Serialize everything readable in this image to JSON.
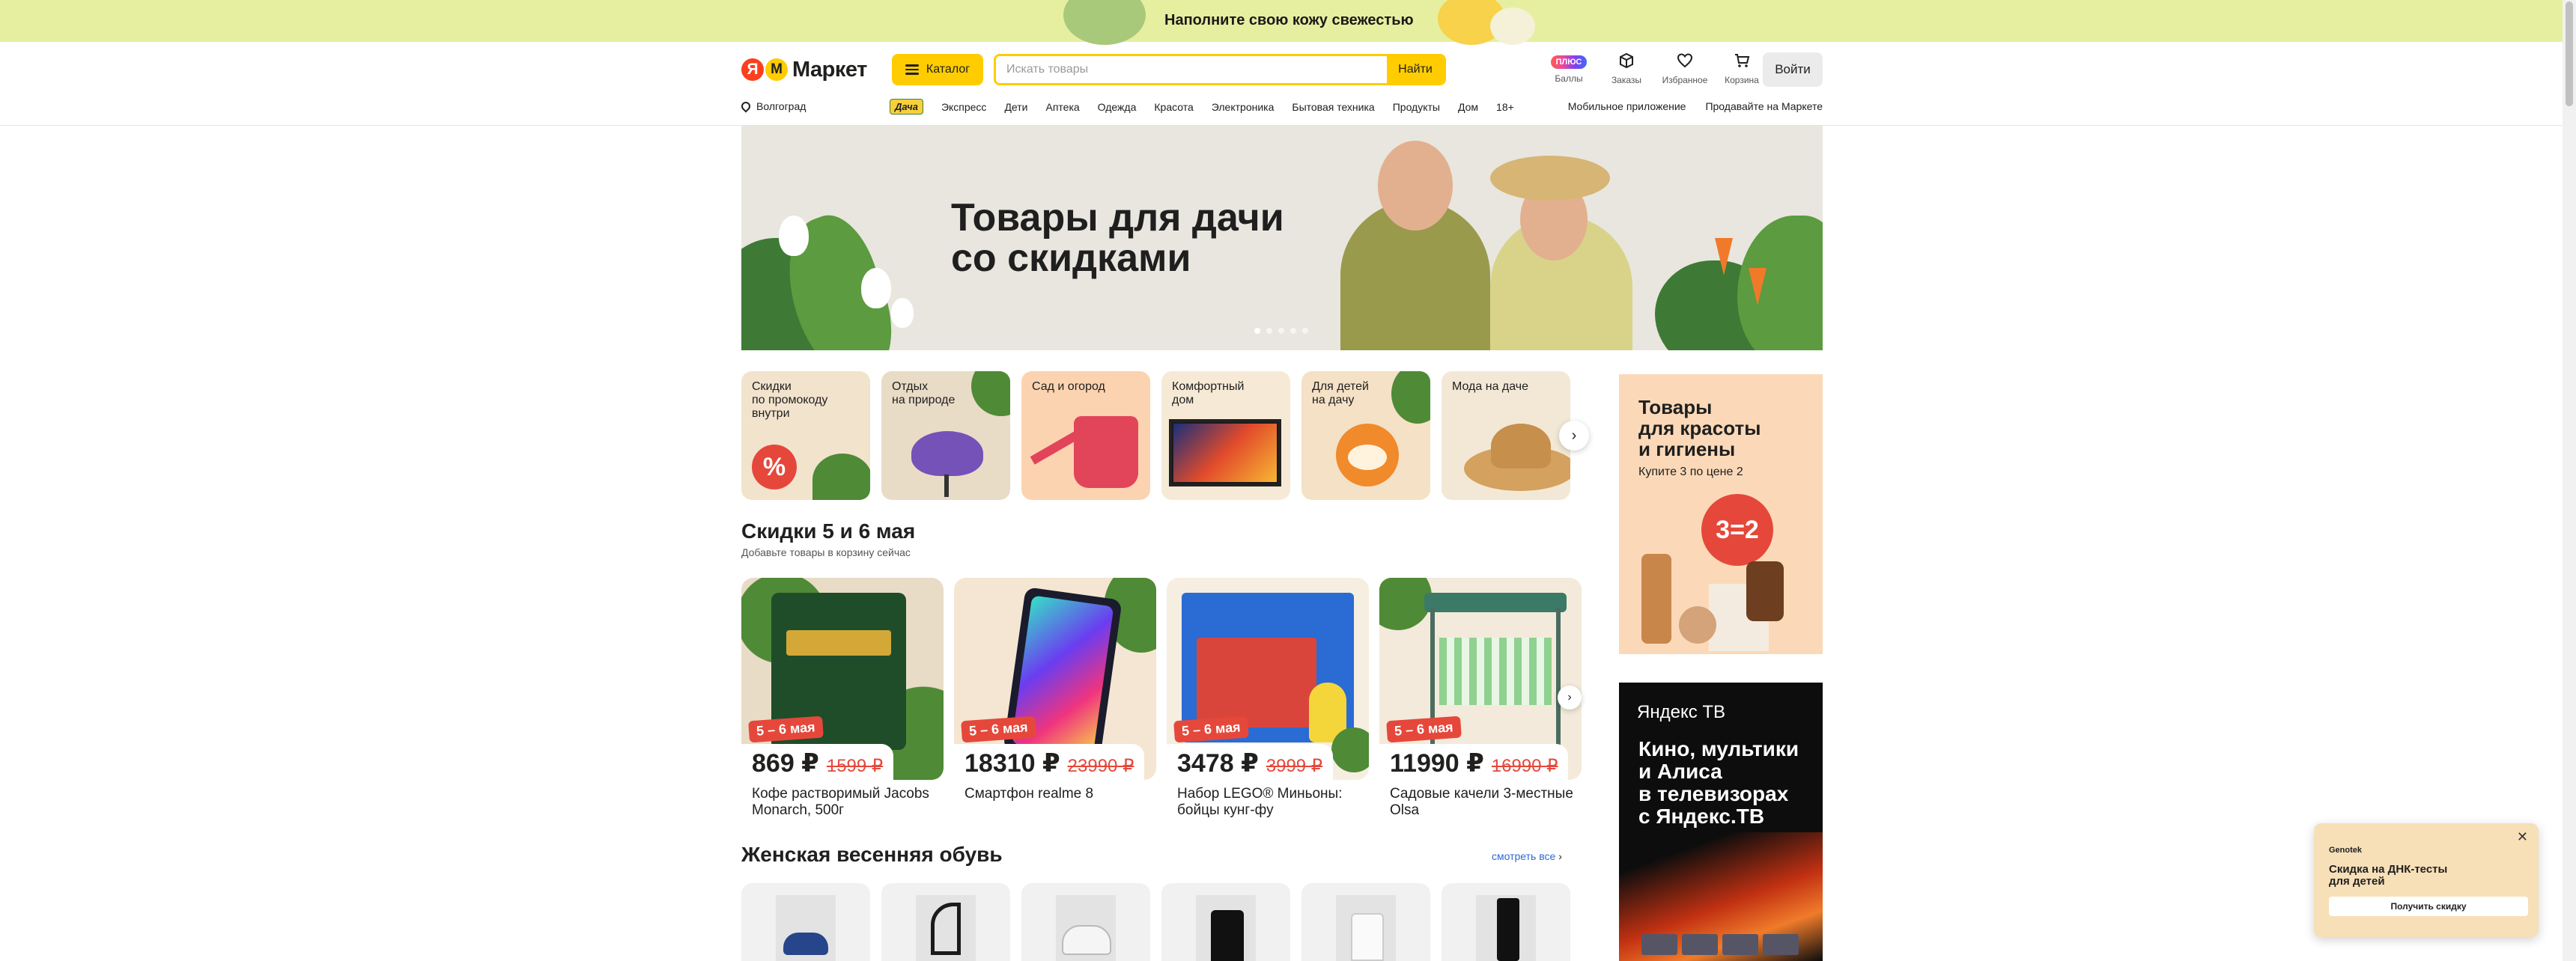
{
  "promo_banner": {
    "text": "Наполните свою кожу свежестью"
  },
  "header": {
    "logo_text": "Маркет",
    "catalog_label": "Каталог",
    "search_placeholder": "Искать товары",
    "search_button": "Найти",
    "plus_badge": "ПЛЮС",
    "icons": [
      {
        "label": "Баллы",
        "icon": "plus-points-icon"
      },
      {
        "label": "Заказы",
        "icon": "box-icon"
      },
      {
        "label": "Избранное",
        "icon": "heart-icon"
      },
      {
        "label": "Корзина",
        "icon": "cart-icon"
      }
    ],
    "login_label": "Войти"
  },
  "nav": {
    "location": "Волгоград",
    "dacha_tag": "Дача",
    "links": [
      "Экспресс",
      "Дети",
      "Аптека",
      "Одежда",
      "Красота",
      "Электроника",
      "Бытовая техника",
      "Продукты",
      "Дом",
      "18+"
    ],
    "right_links": [
      "Мобильное приложение",
      "Продавайте на Маркете"
    ]
  },
  "hero": {
    "title_line1": "Товары для дачи",
    "title_line2": "со скидками",
    "slides_count": 5,
    "active_slide": 1
  },
  "categories": [
    {
      "label": "Скидки\nпо промокоду\nвнутри",
      "bg": "#f2e3cd"
    },
    {
      "label": "Отдых\nна природе",
      "bg": "#e9dcc6"
    },
    {
      "label": "Сад и огород",
      "bg": "#fbd3b0"
    },
    {
      "label": "Комфортный\nдом",
      "bg": "#f6ead7"
    },
    {
      "label": "Для детей\nна дачу",
      "bg": "#f5e1c6"
    },
    {
      "label": "Мода на даче",
      "bg": "#f3e8d6"
    }
  ],
  "deals_section": {
    "title": "Скидки 5 и 6 мая",
    "subtitle": "Добавьте товары в корзину сейчас",
    "items": [
      {
        "date": "5 – 6 мая",
        "price": "869 ₽",
        "old_price": "1599 ₽",
        "name": "Кофе растворимый Jacobs Monarch, 500г",
        "bg": "#e9dcc6"
      },
      {
        "date": "5 – 6 мая",
        "price": "18310 ₽",
        "old_price": "23990 ₽",
        "name": "Смартфон realme 8",
        "bg": "#f4e6d2"
      },
      {
        "date": "5 – 6 мая",
        "price": "3478 ₽",
        "old_price": "3999 ₽",
        "name": "Набор LEGO® Миньоны: бойцы кунг-фу",
        "bg": "#f6eee0"
      },
      {
        "date": "5 – 6 мая",
        "price": "11990 ₽",
        "old_price": "16990 ₽",
        "name": "Садовые качели 3-местные Olsa",
        "bg": "#f3eadb"
      }
    ]
  },
  "shoes_section": {
    "title": "Женская весенняя обувь",
    "see_all": "смотреть все"
  },
  "ad_beauty": {
    "title": "Товары\nдля красоты\nи гигиены",
    "subtitle": "Купите 3 по цене 2",
    "badge": "3=2"
  },
  "ad_tv": {
    "logo": "Яндекс ТВ",
    "title": "Кино, мультики\nи Алиса\nв телевизорах\nс Яндекс.ТВ"
  },
  "popup": {
    "brand": "Genotek",
    "text": "Скидка на ДНК-тесты\nдля детей",
    "button": "Получить скидку"
  },
  "colors": {
    "accent": "#ffcc00",
    "sale": "#e5483b",
    "link": "#2d68d6"
  }
}
